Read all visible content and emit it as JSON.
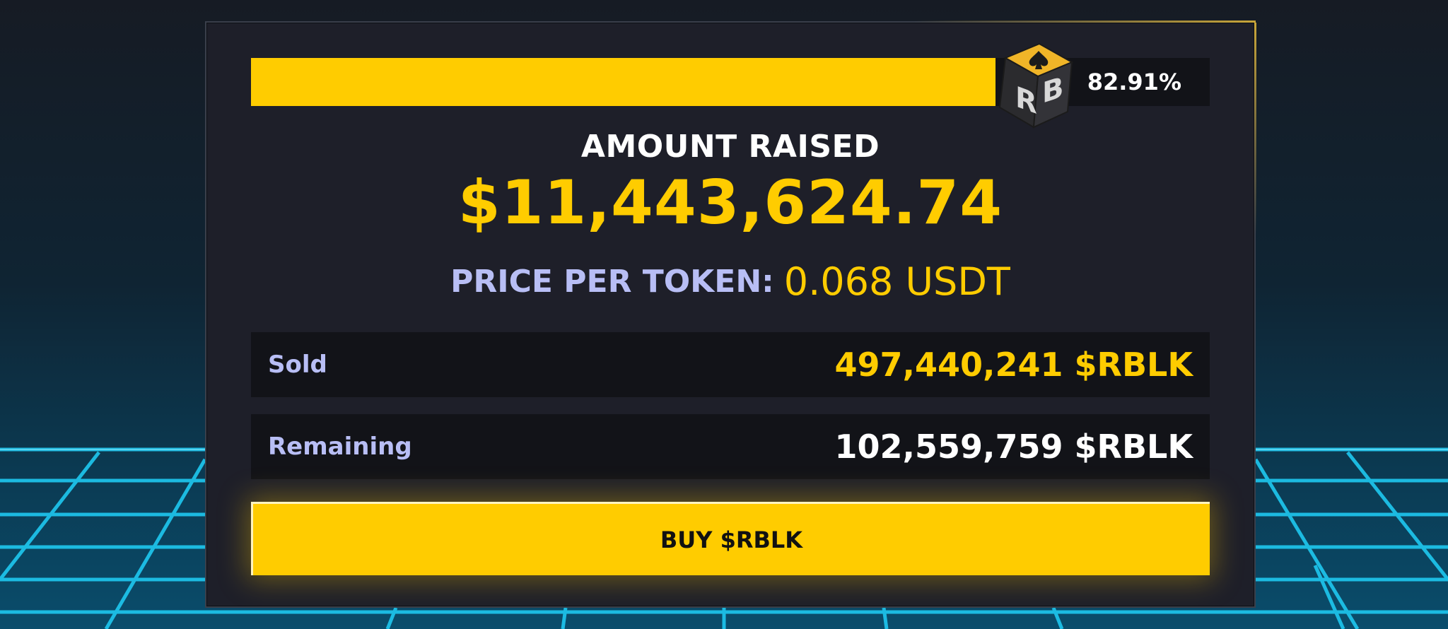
{
  "progress": {
    "percent_label": "82.91%",
    "fraction": 0.7765
  },
  "logo": {
    "letters": "RB"
  },
  "raised": {
    "label": "AMOUNT RAISED",
    "amount": "$11,443,624.74"
  },
  "price": {
    "label": "PRICE PER TOKEN:",
    "value": "0.068 USDT"
  },
  "stats": {
    "sold": {
      "label": "Sold",
      "value": "497,440,241 $RBLK"
    },
    "remaining": {
      "label": "Remaining",
      "value": "102,559,759 $RBLK"
    }
  },
  "buy_button": {
    "label": "BUY $RBLK"
  },
  "colors": {
    "accent": "#ffcc00",
    "card_bg": "#1e1f29",
    "row_bg": "#121318",
    "label_lavender": "#b8bef5",
    "grid_cyan": "#1ec8f0"
  }
}
